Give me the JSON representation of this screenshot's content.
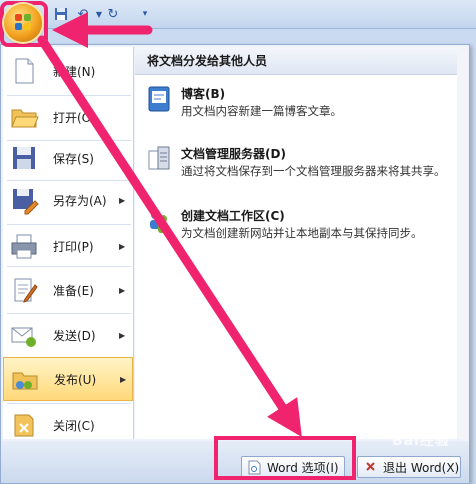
{
  "colors": {
    "accent": "#f0246e",
    "menu_highlight": "#ffd97a"
  },
  "qat": {
    "icons": [
      "office-button-icon",
      "save-icon",
      "undo-icon",
      "redo-icon",
      "customize-qat-icon"
    ]
  },
  "left_menu": {
    "items": [
      {
        "label": "新建(N)",
        "icon": "new-document-icon",
        "has_submenu": false
      },
      {
        "label": "打开(O)",
        "icon": "open-folder-icon",
        "has_submenu": false
      },
      {
        "label": "保存(S)",
        "icon": "save-disk-icon",
        "has_submenu": false
      },
      {
        "label": "另存为(A)",
        "icon": "save-as-icon",
        "has_submenu": true
      },
      {
        "label": "打印(P)",
        "icon": "printer-icon",
        "has_submenu": true
      },
      {
        "label": "准备(E)",
        "icon": "prepare-icon",
        "has_submenu": true
      },
      {
        "label": "发送(D)",
        "icon": "send-icon",
        "has_submenu": true
      },
      {
        "label": "发布(U)",
        "icon": "publish-icon",
        "has_submenu": true,
        "active": true
      },
      {
        "label": "关闭(C)",
        "icon": "close-document-icon",
        "has_submenu": false
      }
    ]
  },
  "right_pane": {
    "header": "将文档分发给其他人员",
    "items": [
      {
        "title": "博客(B)",
        "desc": "用文档内容新建一篇博客文章。",
        "icon": "blog-icon"
      },
      {
        "title": "文档管理服务器(D)",
        "desc": "通过将文档保存到一个文档管理服务器来将其共享。",
        "icon": "document-server-icon"
      },
      {
        "title": "创建文档工作区(C)",
        "desc": "为文档创建新网站并让本地副本与其保持同步。",
        "icon": "workspace-icon"
      }
    ]
  },
  "footer": {
    "word_options": "Word 选项(I)",
    "exit_word": "退出 Word(X)"
  },
  "watermark": "Bai经验"
}
